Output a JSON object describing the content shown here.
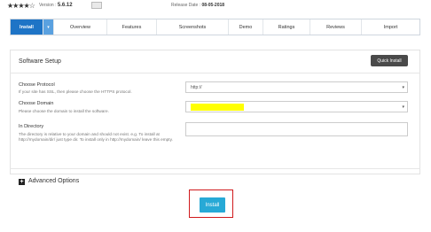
{
  "header": {
    "stars": "★★★★☆",
    "version_label": "Version :",
    "version_value": "5.6.12",
    "release_label": "Release Date :",
    "release_value": "08-05-2018"
  },
  "tabs": [
    {
      "label": "Install",
      "active": true
    },
    {
      "label": "▾"
    },
    {
      "label": "Overview"
    },
    {
      "label": "Features"
    },
    {
      "label": "Screenshots"
    },
    {
      "label": "Demo"
    },
    {
      "label": "Ratings"
    },
    {
      "label": "Reviews"
    },
    {
      "label": "Import"
    }
  ],
  "setup": {
    "title": "Software Setup",
    "quick_install": "Quick Install",
    "protocol_label": "Choose Protocol",
    "protocol_hint": "If your site has SSL, then please choose the HTTPS protocol.",
    "protocol_value": "http://",
    "domain_label": "Choose Domain",
    "domain_hint": "Please choose the domain to install the software.",
    "directory_label": "In Directory",
    "directory_hint": "The directory is relative to your domain and should not exist. e.g. To install at http://mydomain/dir/ just type dir. To install only in http://mydomain/ leave this empty."
  },
  "advanced": {
    "label": "Advanced Options",
    "icon": "plus-icon"
  },
  "install_button": "Install",
  "colors": {
    "accent": "#1e74c6",
    "install": "#27a9d6",
    "highlight_outline": "#d0191c",
    "redaction": "#ffff00"
  }
}
